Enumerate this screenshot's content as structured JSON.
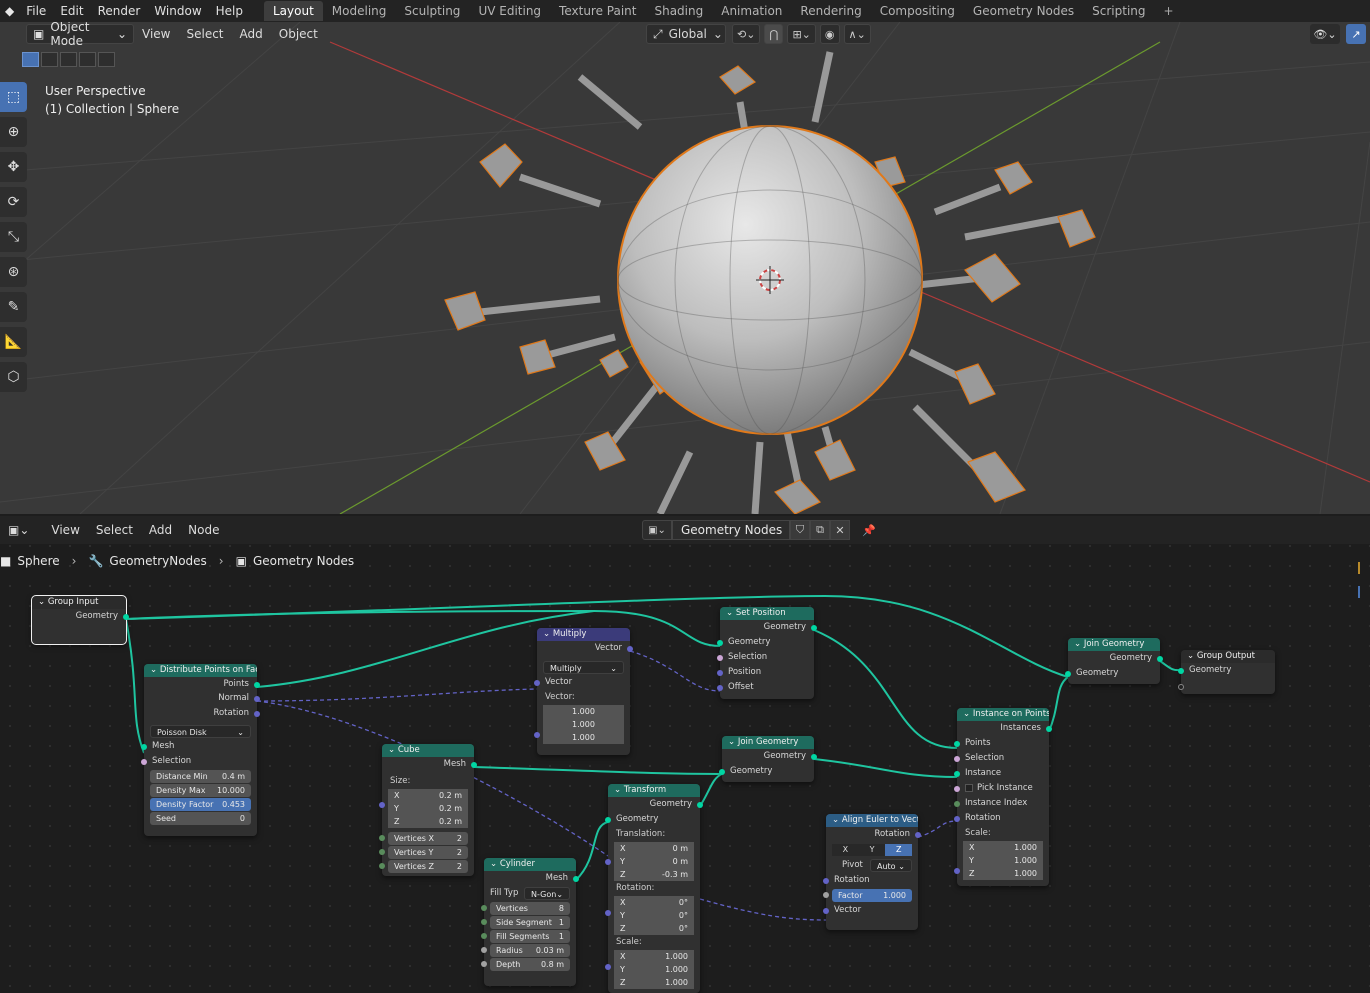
{
  "app": {
    "logo": "◆",
    "menu": [
      "File",
      "Edit",
      "Render",
      "Window",
      "Help"
    ],
    "workspaces": [
      "Layout",
      "Modeling",
      "Sculpting",
      "UV Editing",
      "Texture Paint",
      "Shading",
      "Animation",
      "Rendering",
      "Compositing",
      "Geometry Nodes",
      "Scripting",
      "+"
    ],
    "active_workspace": "Layout"
  },
  "viewport": {
    "mode": "Object Mode",
    "menus": [
      "View",
      "Select",
      "Add",
      "Object"
    ],
    "orientation": "Global",
    "overlay_line1": "User Perspective",
    "overlay_line2": "(1) Collection | Sphere",
    "colors": {
      "background": "#393939",
      "selection": "#e0791a",
      "x_axis": "#b23a3a",
      "y_axis": "#6b9a2e"
    }
  },
  "node_editor": {
    "menus": [
      "View",
      "Select",
      "Add",
      "Node"
    ],
    "tree_name": "Geometry Nodes",
    "breadcrumb": [
      "Sphere",
      "GeometryNodes",
      "Geometry Nodes"
    ],
    "nodes": {
      "group_input": {
        "title": "Group Input",
        "out_geometry": "Geometry"
      },
      "distribute": {
        "title": "Distribute Points on Faces",
        "out_points": "Points",
        "out_normal": "Normal",
        "out_rotation": "Rotation",
        "method": "Poisson Disk",
        "in_mesh": "Mesh",
        "in_selection": "Selection",
        "distance_min_label": "Distance Min",
        "distance_min": "0.4 m",
        "density_max_label": "Density Max",
        "density_max": "10.000",
        "density_factor_label": "Density Factor",
        "density_factor": "0.453",
        "seed_label": "Seed",
        "seed": "0"
      },
      "multiply": {
        "title": "Multiply",
        "out_vector": "Vector",
        "operation": "Multiply",
        "in_vector": "Vector",
        "in_vector2_label": "Vector:",
        "v1": "1.000",
        "v2": "1.000",
        "v3": "1.000"
      },
      "set_position": {
        "title": "Set Position",
        "out_geometry": "Geometry",
        "in_geometry": "Geometry",
        "in_selection": "Selection",
        "in_position": "Position",
        "in_offset": "Offset"
      },
      "cube": {
        "title": "Cube",
        "out_mesh": "Mesh",
        "size_label": "Size:",
        "x": "0.2 m",
        "y": "0.2 m",
        "z": "0.2 m",
        "vx_label": "Vertices X",
        "vx": "2",
        "vy_label": "Vertices Y",
        "vy": "2",
        "vz_label": "Vertices Z",
        "vz": "2"
      },
      "join1": {
        "title": "Join Geometry",
        "out_geometry": "Geometry",
        "in_geometry": "Geometry"
      },
      "join2": {
        "title": "Join Geometry",
        "out_geometry": "Geometry",
        "in_geometry": "Geometry"
      },
      "group_output": {
        "title": "Group Output",
        "in_geometry": "Geometry"
      },
      "cylinder": {
        "title": "Cylinder",
        "out_mesh": "Mesh",
        "fill_label": "Fill Typ",
        "fill": "N-Gon",
        "vertices_label": "Vertices",
        "vertices": "8",
        "side_label": "Side Segment",
        "side": "1",
        "fillseg_label": "Fill Segments",
        "fillseg": "1",
        "radius_label": "Radius",
        "radius": "0.03 m",
        "depth_label": "Depth",
        "depth": "0.8 m"
      },
      "transform": {
        "title": "Transform",
        "out_geometry": "Geometry",
        "in_geometry": "Geometry",
        "translation_label": "Translation:",
        "tx": "0 m",
        "ty": "0 m",
        "tz": "-0.3 m",
        "rotation_label": "Rotation:",
        "rx": "0°",
        "ry": "0°",
        "rz": "0°",
        "scale_label": "Scale:",
        "sx": "1.000",
        "sy": "1.000",
        "sz": "1.000"
      },
      "align_euler": {
        "title": "Align Euler to Vector",
        "out_rotation": "Rotation",
        "axes": [
          "X",
          "Y",
          "Z"
        ],
        "active_axis": "Z",
        "pivot_label": "Pivot",
        "pivot": "Auto",
        "in_rotation": "Rotation",
        "factor_label": "Factor",
        "factor": "1.000",
        "in_vector": "Vector"
      },
      "instance_on_points": {
        "title": "Instance on Points",
        "out_instances": "Instances",
        "in_points": "Points",
        "in_selection": "Selection",
        "in_instance": "Instance",
        "pick_instance": "Pick Instance",
        "in_instance_index": "Instance Index",
        "in_rotation": "Rotation",
        "scale_label": "Scale:",
        "sx": "1.000",
        "sy": "1.000",
        "sz": "1.000"
      }
    },
    "colors": {
      "geometry_socket": "#00d6a3",
      "vector_socket": "#6363c7",
      "header_geometry": "#1e6b5e",
      "header_vector": "#3b3b7a",
      "header_utility": "#2c5d85"
    }
  }
}
